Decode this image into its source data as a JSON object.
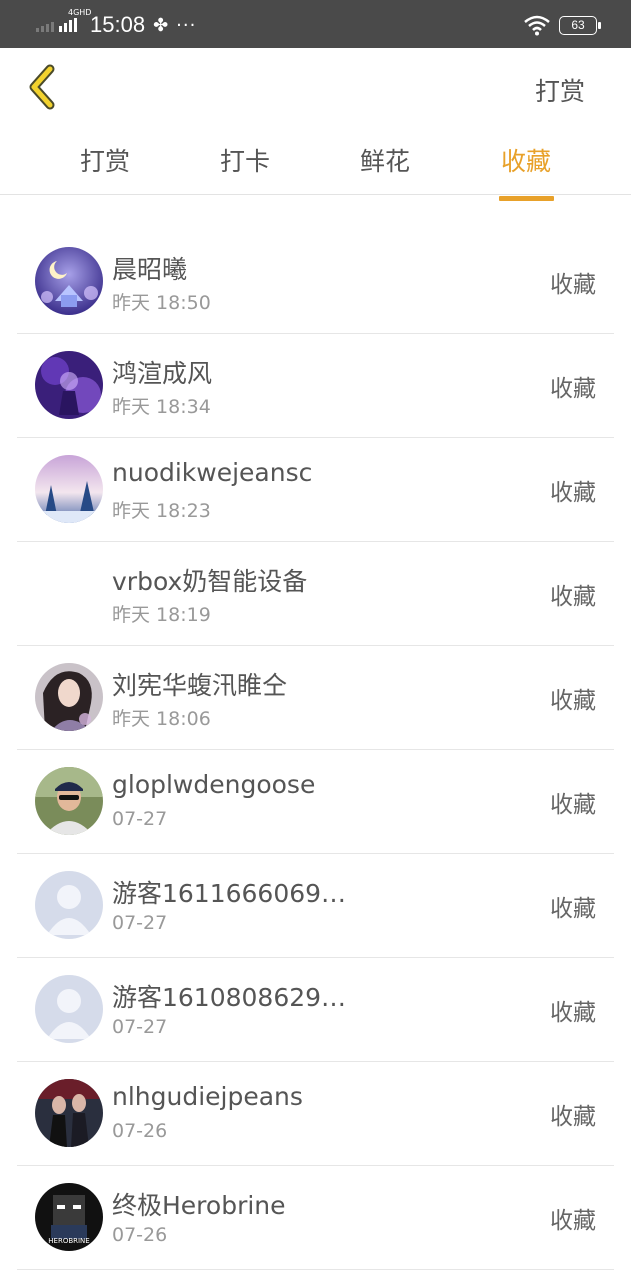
{
  "status_bar": {
    "network": "4GHD",
    "time": "15:08",
    "battery": "63"
  },
  "header": {
    "title": "打赏"
  },
  "tabs": [
    {
      "label": "打赏",
      "active": false
    },
    {
      "label": "打卡",
      "active": false
    },
    {
      "label": "鲜花",
      "active": false
    },
    {
      "label": "收藏",
      "active": true
    }
  ],
  "colors": {
    "accent": "#e8a12a",
    "status_bar": "#4a4a4a"
  },
  "list": [
    {
      "name": "晨昭曦",
      "time": "昨天 18:50",
      "action": "收藏",
      "avatar": "night-house-avatar"
    },
    {
      "name": "鸿渲成风",
      "time": "昨天 18:34",
      "action": "收藏",
      "avatar": "purple-avatar"
    },
    {
      "name": "nuodikwejeansc",
      "time": "昨天 18:23",
      "action": "收藏",
      "avatar": "snow-trees-avatar"
    },
    {
      "name": "vrbox奶智能设备",
      "time": "昨天 18:19",
      "action": "收藏",
      "avatar": "blank-avatar"
    },
    {
      "name": "刘宪华蝮汛睢仝",
      "time": "昨天 18:06",
      "action": "收藏",
      "avatar": "woman-avatar"
    },
    {
      "name": "gloplwdengoose",
      "time": "07-27",
      "action": "收藏",
      "avatar": "man-cap-avatar"
    },
    {
      "name": "游客1611666069…",
      "time": "07-27",
      "action": "收藏",
      "avatar": "default-user-avatar"
    },
    {
      "name": "游客1610808629…",
      "time": "07-27",
      "action": "收藏",
      "avatar": "default-user-avatar"
    },
    {
      "name": "nlhgudiejpeans",
      "time": "07-26",
      "action": "收藏",
      "avatar": "couple-avatar"
    },
    {
      "name": "终极Herobrine",
      "time": "07-26",
      "action": "收藏",
      "avatar": "herobrine-avatar"
    }
  ]
}
